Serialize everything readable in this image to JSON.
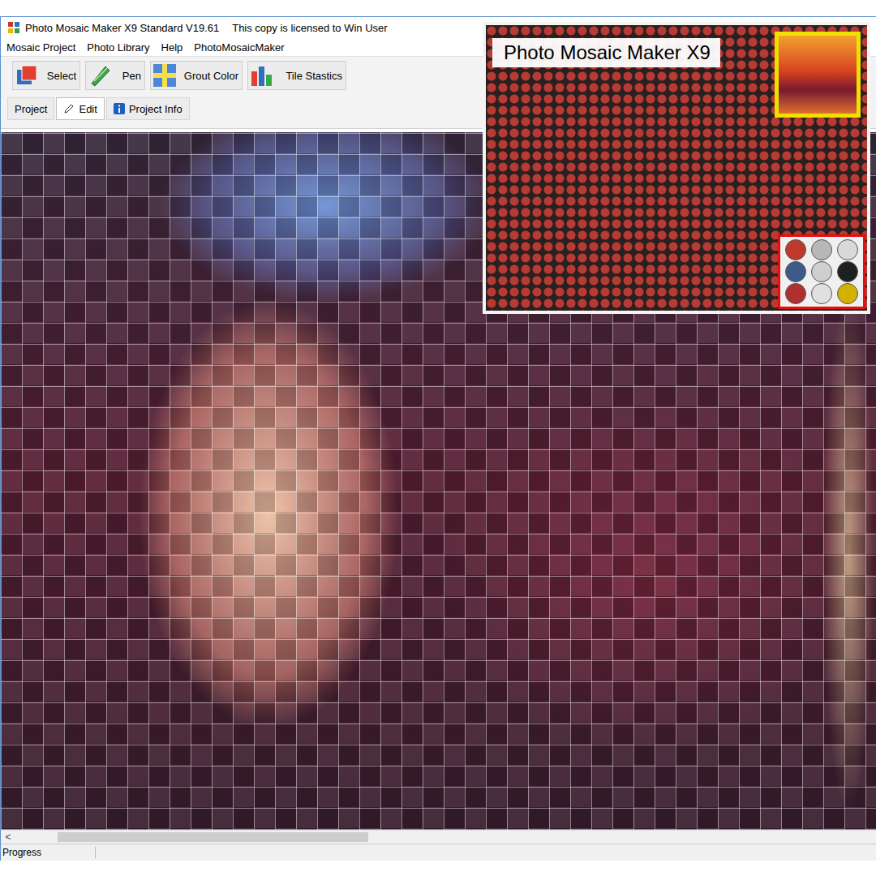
{
  "window": {
    "title": "Photo Mosaic Maker X9 Standard V19.61",
    "license": "This copy is licensed to Win User"
  },
  "menu": [
    "Mosaic Project",
    "Photo Library",
    "Help",
    "PhotoMosaicMaker"
  ],
  "toolbar": [
    {
      "label": "Select",
      "kind": "select"
    },
    {
      "label": "Pen",
      "kind": "pen"
    },
    {
      "label": "Grout Color",
      "kind": "grout"
    },
    {
      "label": "Tile Stastics",
      "kind": "stats"
    }
  ],
  "tabs": [
    {
      "label": "Project",
      "selected": false,
      "kind": "plain"
    },
    {
      "label": "Edit",
      "selected": true,
      "kind": "edit"
    },
    {
      "label": "Project Info",
      "selected": false,
      "kind": "info"
    }
  ],
  "scrollbar": {
    "arrow": "<",
    "level": 0.38
  },
  "status_bar": {
    "text": "Progress"
  },
  "promo": {
    "title": "Photo Mosaic Maker X9"
  }
}
